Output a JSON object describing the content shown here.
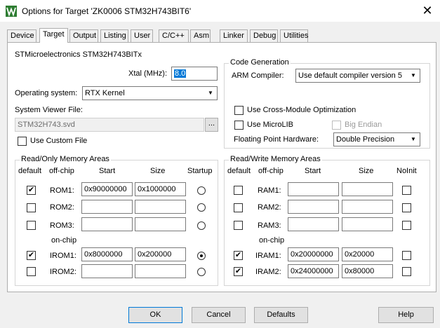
{
  "window": {
    "title": "Options for Target 'ZK0006 STM32H743BIT6'",
    "close_glyph": "✕"
  },
  "tabs": [
    {
      "label": "Device"
    },
    {
      "label": "Target"
    },
    {
      "label": "Output"
    },
    {
      "label": "Listing"
    },
    {
      "label": "User"
    },
    {
      "label": "C/C++"
    },
    {
      "label": "Asm"
    },
    {
      "label": "Linker"
    },
    {
      "label": "Debug"
    },
    {
      "label": "Utilities"
    }
  ],
  "active_tab": "Target",
  "target": {
    "device_name": "STMicroelectronics STM32H743BITx",
    "xtal_label": "Xtal (MHz):",
    "xtal_value": "8.0",
    "os_label": "Operating system:",
    "os_value": "RTX Kernel",
    "svd_label": "System Viewer File:",
    "svd_value": "STM32H743.svd",
    "browse_label": "...",
    "use_custom_file": {
      "label": "Use Custom File",
      "checked": false
    }
  },
  "code_generation": {
    "title": "Code Generation",
    "compiler_label": "ARM Compiler:",
    "compiler_value": "Use default compiler version 5",
    "cross_module": {
      "label": "Use Cross-Module Optimization",
      "checked": false
    },
    "microlib": {
      "label": "Use MicroLIB",
      "checked": false
    },
    "big_endian": {
      "label": "Big Endian",
      "checked": false
    },
    "fpu_label": "Floating Point Hardware:",
    "fpu_value": "Double Precision"
  },
  "rom": {
    "title": "Read/Only Memory Areas",
    "headers": {
      "default": "default",
      "offchip": "off-chip",
      "start": "Start",
      "size": "Size",
      "startup": "Startup"
    },
    "onchip_label": "on-chip",
    "rows": [
      {
        "name": "ROM1:",
        "default": true,
        "start": "0x90000000",
        "size": "0x1000000",
        "startup": false
      },
      {
        "name": "ROM2:",
        "default": false,
        "start": "",
        "size": "",
        "startup": false
      },
      {
        "name": "ROM3:",
        "default": false,
        "start": "",
        "size": "",
        "startup": false
      },
      {
        "name": "IROM1:",
        "default": true,
        "start": "0x8000000",
        "size": "0x200000",
        "startup": true
      },
      {
        "name": "IROM2:",
        "default": false,
        "start": "",
        "size": "",
        "startup": false
      }
    ]
  },
  "ram": {
    "title": "Read/Write Memory Areas",
    "headers": {
      "default": "default",
      "offchip": "off-chip",
      "start": "Start",
      "size": "Size",
      "noinit": "NoInit"
    },
    "onchip_label": "on-chip",
    "rows": [
      {
        "name": "RAM1:",
        "default": false,
        "start": "",
        "size": "",
        "noinit": false
      },
      {
        "name": "RAM2:",
        "default": false,
        "start": "",
        "size": "",
        "noinit": false
      },
      {
        "name": "RAM3:",
        "default": false,
        "start": "",
        "size": "",
        "noinit": false
      },
      {
        "name": "IRAM1:",
        "default": true,
        "start": "0x20000000",
        "size": "0x20000",
        "noinit": false
      },
      {
        "name": "IRAM2:",
        "default": true,
        "start": "0x24000000",
        "size": "0x80000",
        "noinit": false
      }
    ]
  },
  "buttons": {
    "ok": "OK",
    "cancel": "Cancel",
    "defaults": "Defaults",
    "help": "Help"
  },
  "check_glyph": "✔",
  "arrow_glyph": "▼"
}
